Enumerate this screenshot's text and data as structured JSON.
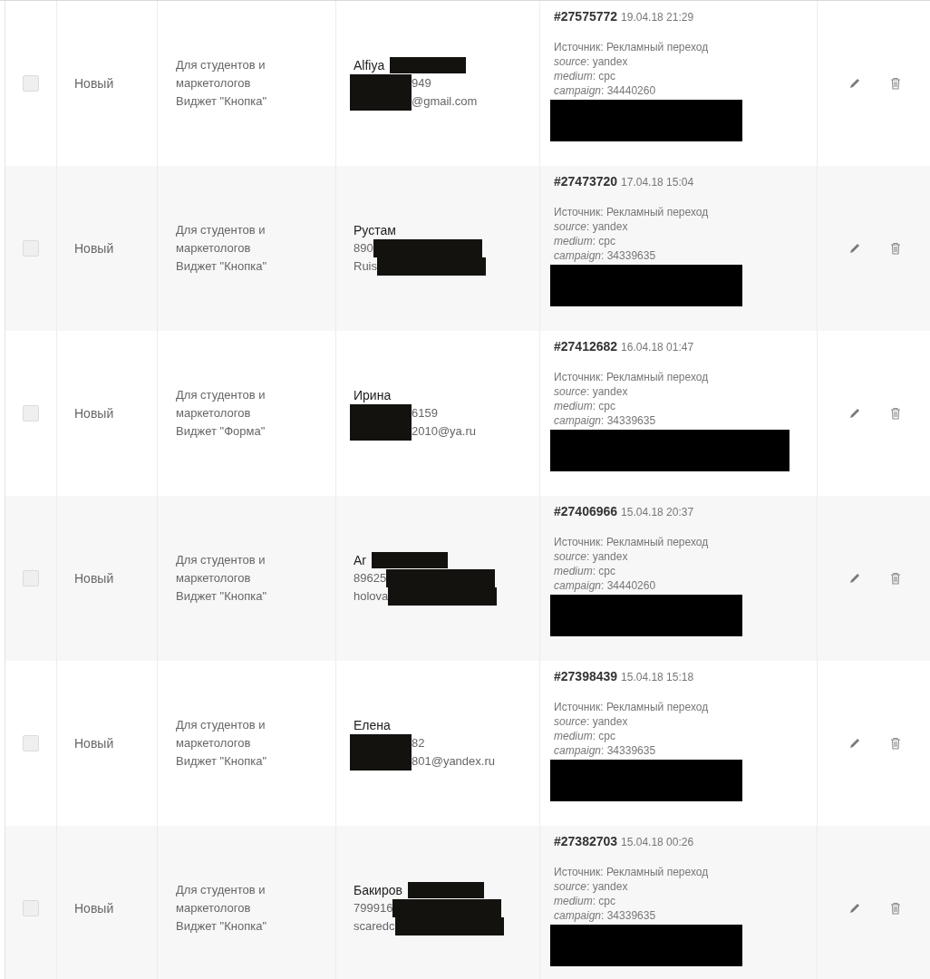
{
  "rows": [
    {
      "checked": false,
      "status": "Новый",
      "description": [
        "Для студентов и",
        "маркетологов",
        "Виджет \"Кнопка\""
      ],
      "contact": [
        [
          {
            "kind": "name",
            "text": "Alfiya"
          },
          {
            "kind": "redaction"
          }
        ],
        [
          {
            "kind": "redaction"
          },
          {
            "kind": "text",
            "text": "949"
          }
        ],
        [
          {
            "kind": "redaction"
          },
          {
            "kind": "text",
            "text": "@gmail.com"
          }
        ]
      ],
      "order": {
        "number": "#27575772",
        "date": "19.04.18 21:29",
        "details": [
          "Источник: Рекламный переход",
          "*source*: yandex",
          "*medium*: cpc",
          "*campaign*: 34440260"
        ]
      }
    },
    {
      "checked": false,
      "status": "Новый",
      "description": [
        "Для студентов и",
        "маркетологов",
        "Виджет \"Кнопка\""
      ],
      "contact": [
        [
          {
            "kind": "name",
            "text": "Рустам"
          }
        ],
        [
          {
            "kind": "text",
            "text": "890"
          },
          {
            "kind": "redaction"
          }
        ],
        [
          {
            "kind": "text",
            "text": "Ruis"
          },
          {
            "kind": "redaction"
          }
        ]
      ],
      "order": {
        "number": "#27473720",
        "date": "17.04.18 15:04",
        "details": [
          "Источник: Рекламный переход",
          "*source*: yandex",
          "*medium*: cpc",
          "*campaign*: 34339635"
        ]
      }
    },
    {
      "checked": false,
      "status": "Новый",
      "description": [
        "Для студентов и",
        "маркетологов",
        "Виджет \"Форма\""
      ],
      "contact": [
        [
          {
            "kind": "name",
            "text": "Ирина"
          }
        ],
        [
          {
            "kind": "redaction"
          },
          {
            "kind": "text",
            "text": "6159"
          }
        ],
        [
          {
            "kind": "redaction"
          },
          {
            "kind": "text",
            "text": "2010@ya.ru"
          }
        ]
      ],
      "order": {
        "number": "#27412682",
        "date": "16.04.18 01:47",
        "details": [
          "Источник: Рекламный переход",
          "*source*: yandex",
          "*medium*: cpc",
          "*campaign*: 34339635"
        ]
      }
    },
    {
      "checked": false,
      "status": "Новый",
      "description": [
        "Для студентов и",
        "маркетологов",
        "Виджет \"Кнопка\""
      ],
      "contact": [
        [
          {
            "kind": "name",
            "text": "Ar"
          },
          {
            "kind": "redaction"
          }
        ],
        [
          {
            "kind": "text",
            "text": "89625"
          },
          {
            "kind": "redaction"
          }
        ],
        [
          {
            "kind": "text",
            "text": "holova"
          },
          {
            "kind": "redaction"
          }
        ]
      ],
      "order": {
        "number": "#27406966",
        "date": "15.04.18 20:37",
        "details": [
          "Источник: Рекламный переход",
          "*source*: yandex",
          "*medium*: cpc",
          "*campaign*: 34440260"
        ]
      }
    },
    {
      "checked": false,
      "status": "Новый",
      "description": [
        "Для студентов и",
        "маркетологов",
        "Виджет \"Кнопка\""
      ],
      "contact": [
        [
          {
            "kind": "name",
            "text": "Елена"
          }
        ],
        [
          {
            "kind": "redaction"
          },
          {
            "kind": "text",
            "text": "82"
          }
        ],
        [
          {
            "kind": "redaction"
          },
          {
            "kind": "text",
            "text": "801@yandex.ru"
          }
        ]
      ],
      "order": {
        "number": "#27398439",
        "date": "15.04.18 15:18",
        "details": [
          "Источник: Рекламный переход",
          "*source*: yandex",
          "*medium*: cpc",
          "*campaign*: 34339635"
        ]
      }
    },
    {
      "checked": false,
      "status": "Новый",
      "description": [
        "Для студентов и",
        "маркетологов",
        "Виджет \"Кнопка\""
      ],
      "contact": [
        [
          {
            "kind": "name",
            "text": "Бакиров"
          },
          {
            "kind": "redaction"
          }
        ],
        [
          {
            "kind": "text",
            "text": "799916"
          },
          {
            "kind": "redaction"
          }
        ],
        [
          {
            "kind": "text",
            "text": "scaredc"
          },
          {
            "kind": "redaction"
          }
        ]
      ],
      "order": {
        "number": "#27382703",
        "date": "15.04.18 00:26",
        "details": [
          "Источник: Рекламный переход",
          "*source*: yandex",
          "*medium*: cpc",
          "*campaign*: 34339635"
        ]
      }
    }
  ]
}
